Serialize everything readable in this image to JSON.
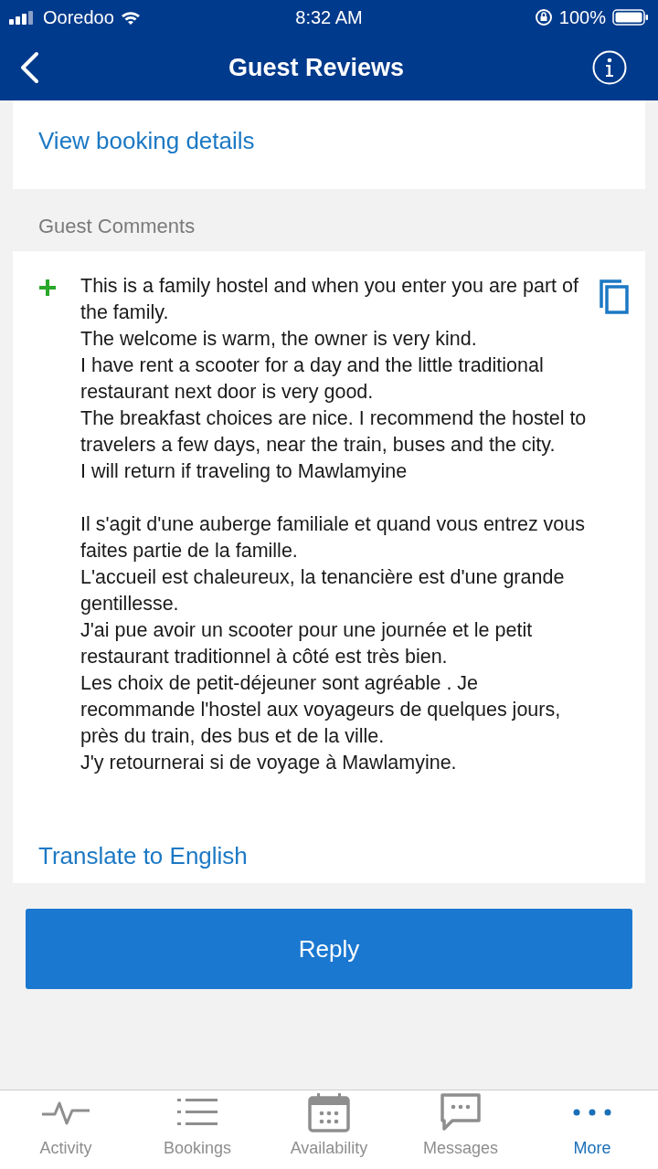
{
  "status_bar": {
    "carrier": "Ooredoo",
    "time": "8:32 AM",
    "battery": "100%"
  },
  "header": {
    "title": "Guest Reviews"
  },
  "booking_link": "View booking details",
  "section_title": "Guest Comments",
  "comment": {
    "paragraphs": [
      [
        "This is a family hostel and when you enter you are part of the family.",
        "The welcome is warm, the owner is very kind.",
        "I have rent a scooter for a day and the little traditional restaurant next door is very good.",
        "The breakfast choices are nice. I recommend the hostel to travelers a few days, near the train, buses and the city.",
        "I will return if traveling to Mawlamyine"
      ],
      [
        "Il s'agit d'une auberge familiale et quand vous entrez vous faites partie de la famille.",
        "L'accueil est chaleureux, la tenancière est d'une grande gentillesse.",
        "J'ai pue avoir un scooter pour une journée et le petit restaurant traditionnel à côté est très bien.",
        "Les choix de petit-déjeuner sont agréable . Je recommande l'hostel aux voyageurs de quelques jours, près du train, des bus et de la ville.",
        "J'y retournerai si de voyage à Mawlamyine."
      ]
    ],
    "translate_link": "Translate to English"
  },
  "reply_button": "Reply",
  "tabs": [
    {
      "kind": "activity",
      "label": "Activity",
      "selected": false
    },
    {
      "kind": "bookings",
      "label": "Bookings",
      "selected": false
    },
    {
      "kind": "availability",
      "label": "Availability",
      "selected": false
    },
    {
      "kind": "messages",
      "label": "Messages",
      "selected": false
    },
    {
      "kind": "more",
      "label": "More",
      "selected": true
    }
  ]
}
